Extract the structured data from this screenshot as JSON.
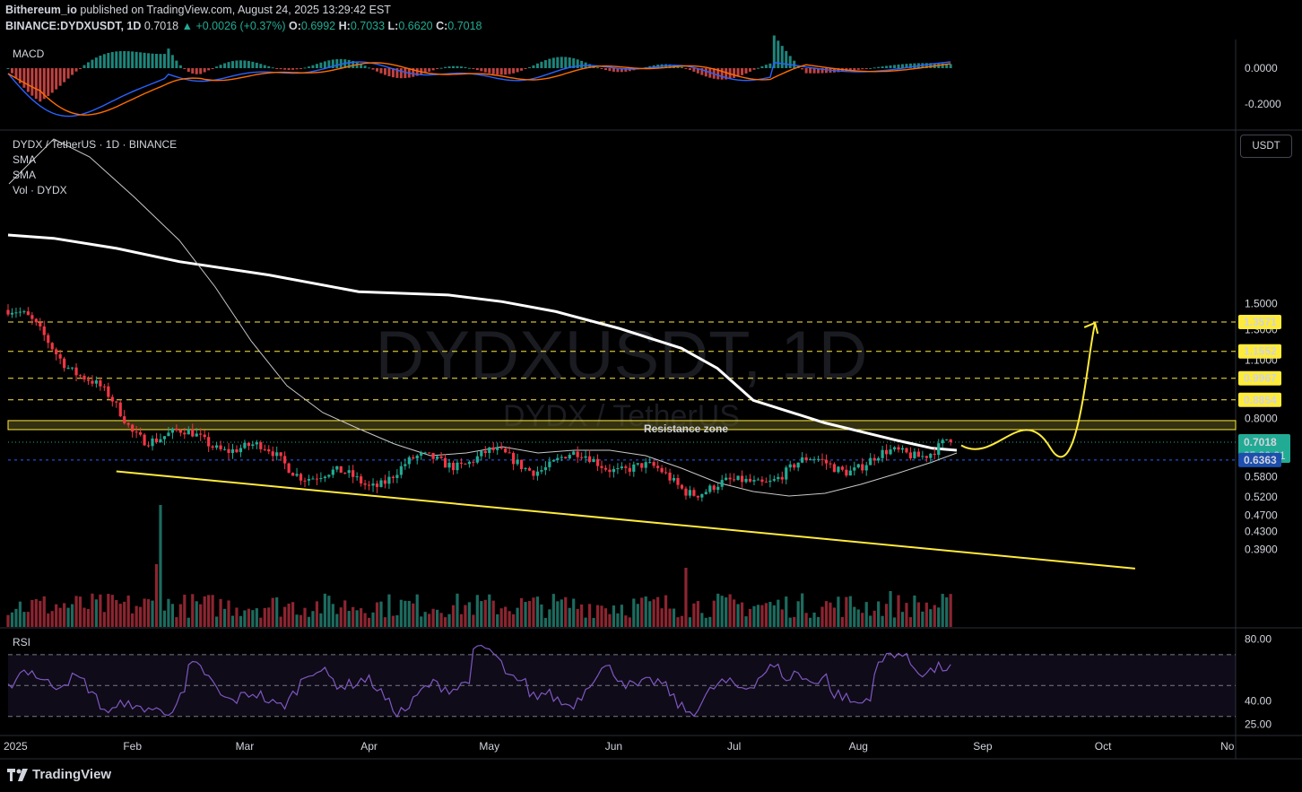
{
  "header": {
    "user": "Bithereum_io",
    "published_text": "published on TradingView.com, August 24, 2025 13:29:42 EST",
    "symbol": "BINANCE:DYDXUSDT, 1D",
    "price": "0.7018",
    "change": "▲ +0.0026 (+0.37%)",
    "o_label": "O:",
    "o": "0.6992",
    "h_label": "H:",
    "h": "0.7033",
    "l_label": "L:",
    "l": "0.6620",
    "c_label": "C:",
    "c": "0.7018"
  },
  "panels": {
    "macd_label": "MACD",
    "rsi_label": "RSI",
    "main_title": "DYDX / TetherUS · 1D · BINANCE",
    "sma1": "SMA",
    "sma2": "SMA",
    "vol": "Vol · DYDX",
    "unit": "USDT"
  },
  "watermark": {
    "symbol": "DYDXUSDT, 1D",
    "name": "DYDX / TetherUS"
  },
  "resistance_label": "Resistance zone",
  "footer": {
    "brand": "TradingView"
  },
  "colors": {
    "up": "#22ab94",
    "down": "#f23645",
    "sma_slow": "#ffffff",
    "sma_fast": "#c8c8c8",
    "target": "#ffeb3b",
    "zone": "#5c5a20",
    "price_badge": "#22ab94",
    "support_badge": "#1e4fae",
    "macd_line": "#2962ff",
    "signal_line": "#ff6d00",
    "rsi_line": "#7e57c2"
  },
  "chart_data": {
    "type": "candlestick",
    "symbol": "DYDXUSDT",
    "interval": "1D",
    "x_ticks": [
      "2025",
      "Feb",
      "Mar",
      "Apr",
      "May",
      "Jun",
      "Jul",
      "Aug",
      "Sep",
      "Oct",
      "No"
    ],
    "y_ticks": [
      "1.5000",
      "1.3000",
      "1.1000",
      "0.8000",
      "0.5800",
      "0.5200",
      "0.4700",
      "0.4300",
      "0.3900"
    ],
    "ylim": [
      0.36,
      1.62
    ],
    "y_scale": "log",
    "last_price": 0.7018,
    "countdown": "05:30:21",
    "support_level": 0.6363,
    "target_levels": [
      {
        "value": 1.3571,
        "label": "1.3571"
      },
      {
        "value": 1.1552,
        "label": "1.1552"
      },
      {
        "value": 0.9967,
        "label": "0.9967"
      },
      {
        "value": 0.8854,
        "label": "0.8854"
      }
    ],
    "resistance_zone": [
      0.752,
      0.79
    ],
    "trendline": {
      "start_date": "2025-01-28",
      "start": 0.598,
      "end_date": "2025-10-09",
      "end": 0.351
    },
    "projection": {
      "from": 0.69,
      "to": 1.3571,
      "end_date": "2025-09-29"
    },
    "monthly_closes": [
      {
        "date": "2025-01-01",
        "price": 1.45
      },
      {
        "date": "2025-02-01",
        "price": 0.78
      },
      {
        "date": "2025-03-01",
        "price": 0.66
      },
      {
        "date": "2025-04-01",
        "price": 0.57
      },
      {
        "date": "2025-05-01",
        "price": 0.66
      },
      {
        "date": "2025-06-01",
        "price": 0.61
      },
      {
        "date": "2025-07-01",
        "price": 0.55
      },
      {
        "date": "2025-08-01",
        "price": 0.64
      },
      {
        "date": "2025-08-24",
        "price": 0.7018
      }
    ],
    "macd": {
      "y_ticks": [
        "0.0000",
        "-0.2000"
      ],
      "ylim": [
        -0.34,
        0.1
      ]
    },
    "rsi": {
      "y_ticks": [
        "80.00",
        "40.00",
        "25.00"
      ],
      "levels": [
        70,
        50,
        30
      ],
      "ylim": [
        20,
        85
      ]
    }
  }
}
